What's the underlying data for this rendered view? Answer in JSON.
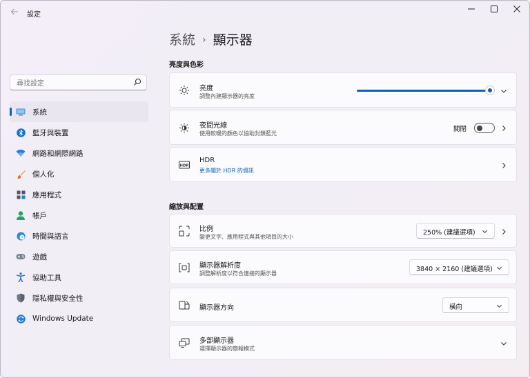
{
  "window": {
    "title": "設定",
    "controls": {
      "minimize": "—",
      "maximize": "☐",
      "close": "✕"
    }
  },
  "search": {
    "placeholder": "尋找設定"
  },
  "sidebar": {
    "items": [
      {
        "label": "系統",
        "icon": "system-icon",
        "selected": true
      },
      {
        "label": "藍牙與裝置",
        "icon": "bluetooth-icon"
      },
      {
        "label": "網路和網際網路",
        "icon": "wifi-icon"
      },
      {
        "label": "個人化",
        "icon": "paintbrush-icon"
      },
      {
        "label": "應用程式",
        "icon": "apps-icon"
      },
      {
        "label": "帳戶",
        "icon": "person-icon"
      },
      {
        "label": "時間與語言",
        "icon": "globe-clock-icon"
      },
      {
        "label": "遊戲",
        "icon": "gamepad-icon"
      },
      {
        "label": "協助工具",
        "icon": "accessibility-icon"
      },
      {
        "label": "隱私權與安全性",
        "icon": "shield-icon"
      },
      {
        "label": "Windows Update",
        "icon": "update-icon"
      }
    ]
  },
  "breadcrumb": {
    "parent": "系統",
    "separator": "›",
    "current": "顯示器"
  },
  "sections": {
    "brightness_color": {
      "title": "亮度與色彩",
      "brightness": {
        "title": "亮度",
        "subtitle": "調整內建顯示器的亮度",
        "value_percent": 100
      },
      "night_light": {
        "title": "夜間光線",
        "subtitle": "使用較暖的顏色以協助封鎖藍光",
        "state_label": "關閉",
        "on": false
      },
      "hdr": {
        "title": "HDR",
        "link": "更多關於 HDR 的資訊",
        "badge": "HDR"
      }
    },
    "scale_layout": {
      "title": "縮放與配置",
      "scale": {
        "title": "比例",
        "subtitle": "變更文字、應用程式與其他項目的大小",
        "value": "250% (建議選項)"
      },
      "resolution": {
        "title": "顯示器解析度",
        "subtitle": "調整解析度以符合連接的顯示器",
        "value": "3840 × 2160 (建議選項)"
      },
      "orientation": {
        "title": "顯示器方向",
        "value": "橫向"
      },
      "multiple": {
        "title": "多部顯示器",
        "subtitle": "選擇顯示器的簡報模式"
      }
    }
  },
  "colors": {
    "accent": "#0a5fb4"
  }
}
